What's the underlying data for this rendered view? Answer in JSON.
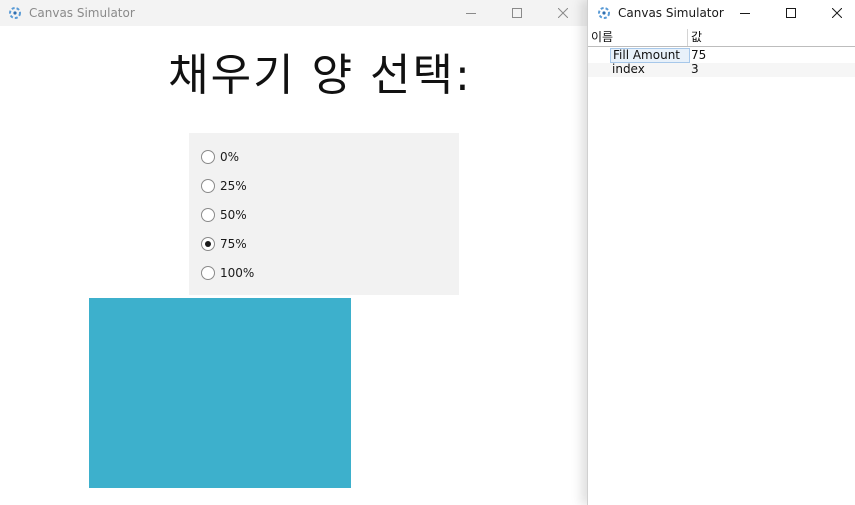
{
  "left_window": {
    "title": "Canvas Simulator",
    "heading": "채우기 양 선택:",
    "radio_options": [
      {
        "label": "0%",
        "checked": false
      },
      {
        "label": "25%",
        "checked": false
      },
      {
        "label": "50%",
        "checked": false
      },
      {
        "label": "75%",
        "checked": true
      },
      {
        "label": "100%",
        "checked": false
      }
    ],
    "fill_amount_percent": 75,
    "fill_color": "#3db0cc"
  },
  "right_window": {
    "title": "Canvas Simulator",
    "columns": [
      "이름",
      "값"
    ],
    "rows": [
      {
        "name": "Fill Amount",
        "value": "75"
      },
      {
        "name": "index",
        "value": "3"
      }
    ]
  },
  "icons": [
    "app-icon",
    "minimize-icon",
    "maximize-icon",
    "close-icon"
  ]
}
